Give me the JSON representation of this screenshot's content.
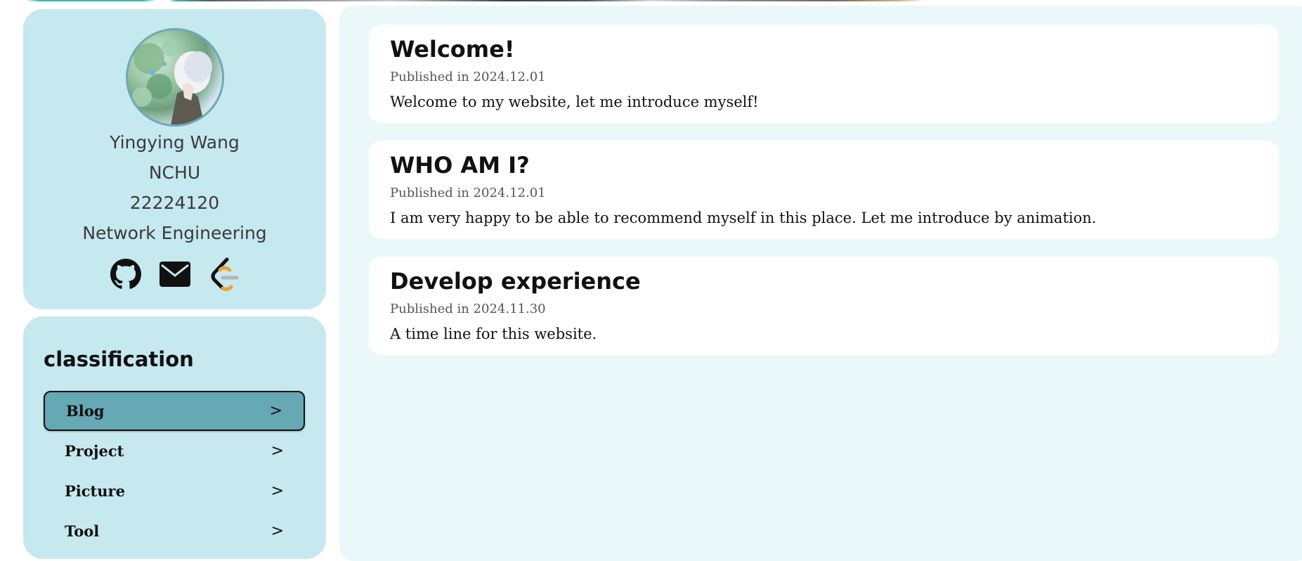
{
  "profile": {
    "name": "Yingying Wang",
    "school": "NCHU",
    "student_id": "22224120",
    "major": "Network Engineering",
    "social_icons": [
      "github-icon",
      "mail-icon",
      "leetcode-icon"
    ]
  },
  "classification": {
    "title": "classification",
    "items": [
      {
        "label": "Blog",
        "arrow": ">",
        "active": true
      },
      {
        "label": "Project",
        "arrow": ">",
        "active": false
      },
      {
        "label": "Picture",
        "arrow": ">",
        "active": false
      },
      {
        "label": "Tool",
        "arrow": ">",
        "active": false
      }
    ]
  },
  "posts": [
    {
      "title": "Welcome!",
      "date": "Published in 2024.12.01",
      "description": "Welcome to my website, let me introduce myself!"
    },
    {
      "title": "WHO AM I?",
      "date": "Published in 2024.12.01",
      "description": "I am very happy to be able to recommend myself in this place. Let me introduce by animation."
    },
    {
      "title": "Develop experience",
      "date": "Published in 2024.11.30",
      "description": "A time line for this website."
    }
  ],
  "colors": {
    "sidebar_bg": "#c6e8ef",
    "main_bg": "#ebf8fa",
    "active_item_bg": "#67a8b5",
    "leetcode_orange": "#f0a13a"
  }
}
